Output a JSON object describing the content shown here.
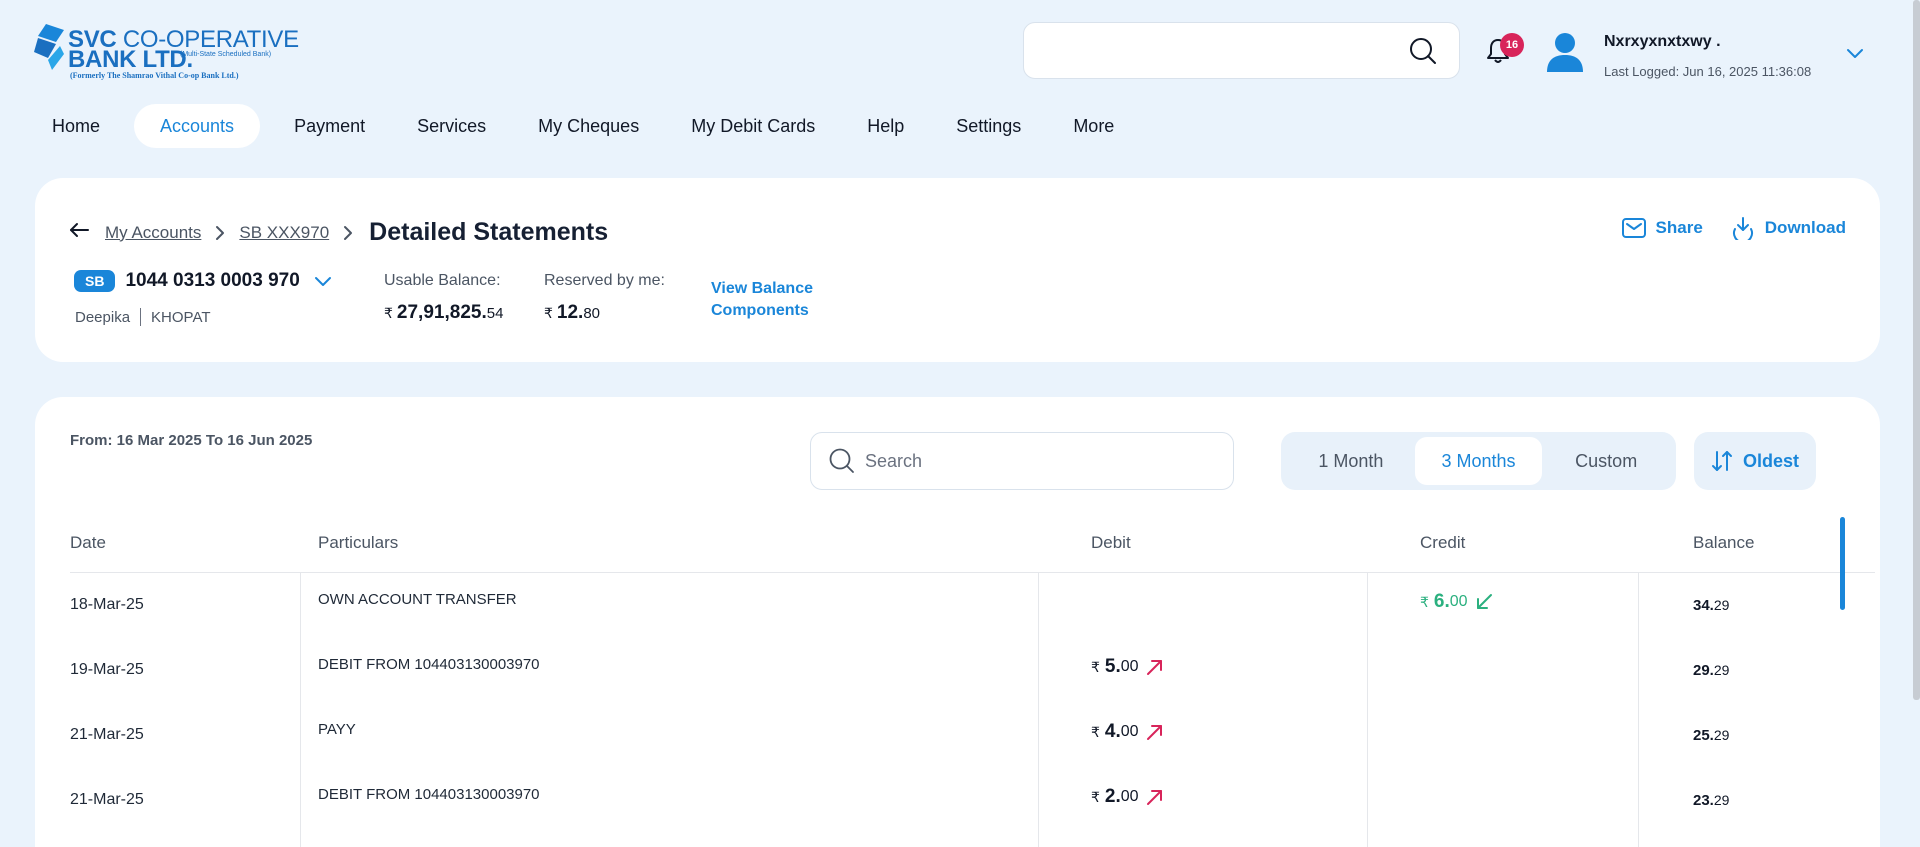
{
  "logo": {
    "line1_bold": "SVC",
    "line1_rest": " CO-OPERATIVE",
    "line2_bold": "BANK LTD.",
    "line2_small": "(Multi-State Scheduled Bank)",
    "line3": "(Formerly The Shamrao Vithal Co-op Bank Ltd.)"
  },
  "header": {
    "search_placeholder": "",
    "notification_count": "16",
    "user_name": "Nxrxyxnxtxwy .",
    "last_logged": "Last Logged: Jun 16, 2025 11:36:08"
  },
  "nav": {
    "items": [
      {
        "label": "Home"
      },
      {
        "label": "Accounts"
      },
      {
        "label": "Payment"
      },
      {
        "label": "Services"
      },
      {
        "label": "My Cheques"
      },
      {
        "label": "My Debit Cards"
      },
      {
        "label": "Help"
      },
      {
        "label": "Settings"
      },
      {
        "label": "More"
      }
    ],
    "active": "Accounts"
  },
  "breadcrumb": {
    "items": [
      "My Accounts",
      "SB XXX970"
    ],
    "title": "Detailed Statements"
  },
  "actions": {
    "share": "Share",
    "download": "Download"
  },
  "account": {
    "type": "SB",
    "number": "1044 0313 0003 970",
    "holder": "Deepika",
    "branch": "KHOPAT",
    "usable_label": "Usable Balance:",
    "usable_currency": "₹",
    "usable_int": "27,91,825.",
    "usable_dec": "54",
    "reserved_label": "Reserved by me:",
    "reserved_currency": "₹",
    "reserved_int": "12.",
    "reserved_dec": "80",
    "view_components": "View Balance Components"
  },
  "statement": {
    "range": "From: 16 Mar 2025 To 16 Jun 2025",
    "search_placeholder": "Search",
    "periods": [
      "1 Month",
      "3 Months",
      "Custom"
    ],
    "active_period": "3 Months",
    "sort_label": "Oldest",
    "columns": {
      "date": "Date",
      "particulars": "Particulars",
      "debit": "Debit",
      "credit": "Credit",
      "balance": "Balance"
    },
    "rows": [
      {
        "date": "18-Mar-25",
        "particulars": "OWN ACCOUNT TRANSFER",
        "debit_int": "",
        "debit_dec": "",
        "credit_int": "6.",
        "credit_dec": "00",
        "balance_int": "34.",
        "balance_dec": "29"
      },
      {
        "date": "19-Mar-25",
        "particulars": "DEBIT FROM 104403130003970",
        "debit_int": "5.",
        "debit_dec": "00",
        "credit_int": "",
        "credit_dec": "",
        "balance_int": "29.",
        "balance_dec": "29"
      },
      {
        "date": "21-Mar-25",
        "particulars": "PAYY",
        "debit_int": "4.",
        "debit_dec": "00",
        "credit_int": "",
        "credit_dec": "",
        "balance_int": "25.",
        "balance_dec": "29"
      },
      {
        "date": "21-Mar-25",
        "particulars": "DEBIT FROM 104403130003970",
        "debit_int": "2.",
        "debit_dec": "00",
        "credit_int": "",
        "credit_dec": "",
        "balance_int": "23.",
        "balance_dec": "29"
      }
    ],
    "currency": "₹"
  },
  "colors": {
    "accent": "#1a86d9",
    "credit": "#2bb07f",
    "debit_arrow": "#d8245a",
    "badge": "#d8245a",
    "background": "#eaf3fc"
  }
}
